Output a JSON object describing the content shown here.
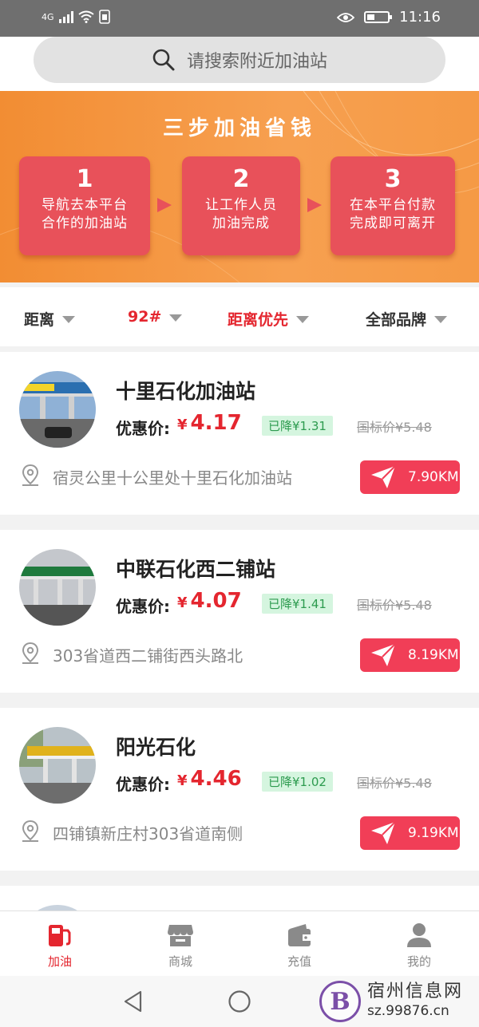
{
  "status_bar": {
    "network": "4G",
    "time": "11:16"
  },
  "search": {
    "placeholder": "请搜索附近加油站"
  },
  "banner": {
    "title": "三步加油省钱",
    "steps": [
      {
        "num": "1",
        "line1": "导航去本平台",
        "line2": "合作的加油站"
      },
      {
        "num": "2",
        "line1": "让工作人员",
        "line2": "加油完成"
      },
      {
        "num": "3",
        "line1": "在本平台付款",
        "line2": "完成即可离开"
      }
    ]
  },
  "filters": [
    {
      "label": "距离"
    },
    {
      "label": "92#"
    },
    {
      "label": "距离优先"
    },
    {
      "label": "全部品牌"
    }
  ],
  "price_label": "优惠价:",
  "currency": "¥",
  "stations": [
    {
      "name": "十里石化加油站",
      "price": "4.17",
      "discount": "已降¥1.31",
      "std_price": "国标价¥5.48",
      "address": "宿灵公里十公里处十里石化加油站",
      "distance": "7.90KM"
    },
    {
      "name": "中联石化西二铺站",
      "price": "4.07",
      "discount": "已降¥1.41",
      "std_price": "国标价¥5.48",
      "address": "303省道西二铺街西头路北",
      "distance": "8.19KM"
    },
    {
      "name": "阳光石化",
      "price": "4.46",
      "discount": "已降¥1.02",
      "std_price": "国标价¥5.48",
      "address": "四铺镇新庄村303省道南侧",
      "distance": "9.19KM"
    }
  ],
  "tabs": [
    {
      "label": "加油",
      "icon": "fuel-pump-icon",
      "active": true
    },
    {
      "label": "商城",
      "icon": "store-icon",
      "active": false
    },
    {
      "label": "充值",
      "icon": "wallet-icon",
      "active": false
    },
    {
      "label": "我的",
      "icon": "user-icon",
      "active": false
    }
  ],
  "watermark": {
    "logo_letter": "B",
    "title": "宿州信息网",
    "url": "sz.99876.cn"
  },
  "colors": {
    "accent": "#e4262f",
    "nav_button": "#f13e57",
    "banner": "#f28d33",
    "step_box": "#e8515a",
    "discount_bg": "#d5f5df"
  }
}
